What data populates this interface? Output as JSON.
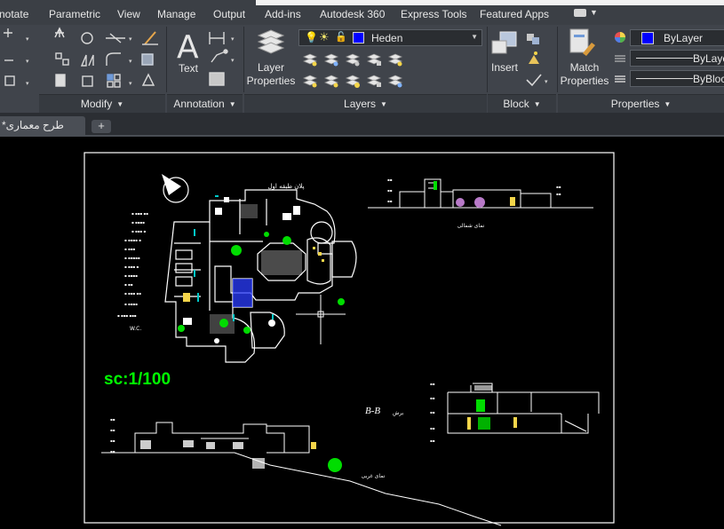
{
  "menu": {
    "items": [
      "notate",
      "Parametric",
      "View",
      "Manage",
      "Output",
      "Add-ins",
      "Autodesk 360",
      "Express Tools",
      "Featured Apps"
    ]
  },
  "ribbon": {
    "panels": {
      "modify": "Modify",
      "annotation": "Annotation",
      "layers": "Layers",
      "block": "Block",
      "properties": "Properties"
    },
    "text_button": "Text",
    "layer_properties_line1": "Layer",
    "layer_properties_line2": "Properties",
    "current_layer": "Heden",
    "insert_button": "Insert",
    "match_properties_line1": "Match",
    "match_properties_line2": "Properties",
    "color_value": "ByLayer",
    "linetype_value": "ByLayer",
    "lineweight_value": "ByBlock"
  },
  "tabs": {
    "document": "طرح معماری*",
    "add_label": "+"
  },
  "drawing": {
    "scale_label": "sc:1/100",
    "plan_title": "پلان طبقه اول",
    "north_elevation_title": "نمای شمالی",
    "west_elevation_title": "نمای غربی",
    "section_label": "B-B",
    "section_suffix": "برش",
    "wc_label": "W.C."
  },
  "colors": {
    "menubar_bg": "#3b3f45",
    "ribbon_bg": "#40444b",
    "canvas_bg": "#000000",
    "layer_swatch": "#0000ff",
    "scale_green": "#00ff00"
  }
}
